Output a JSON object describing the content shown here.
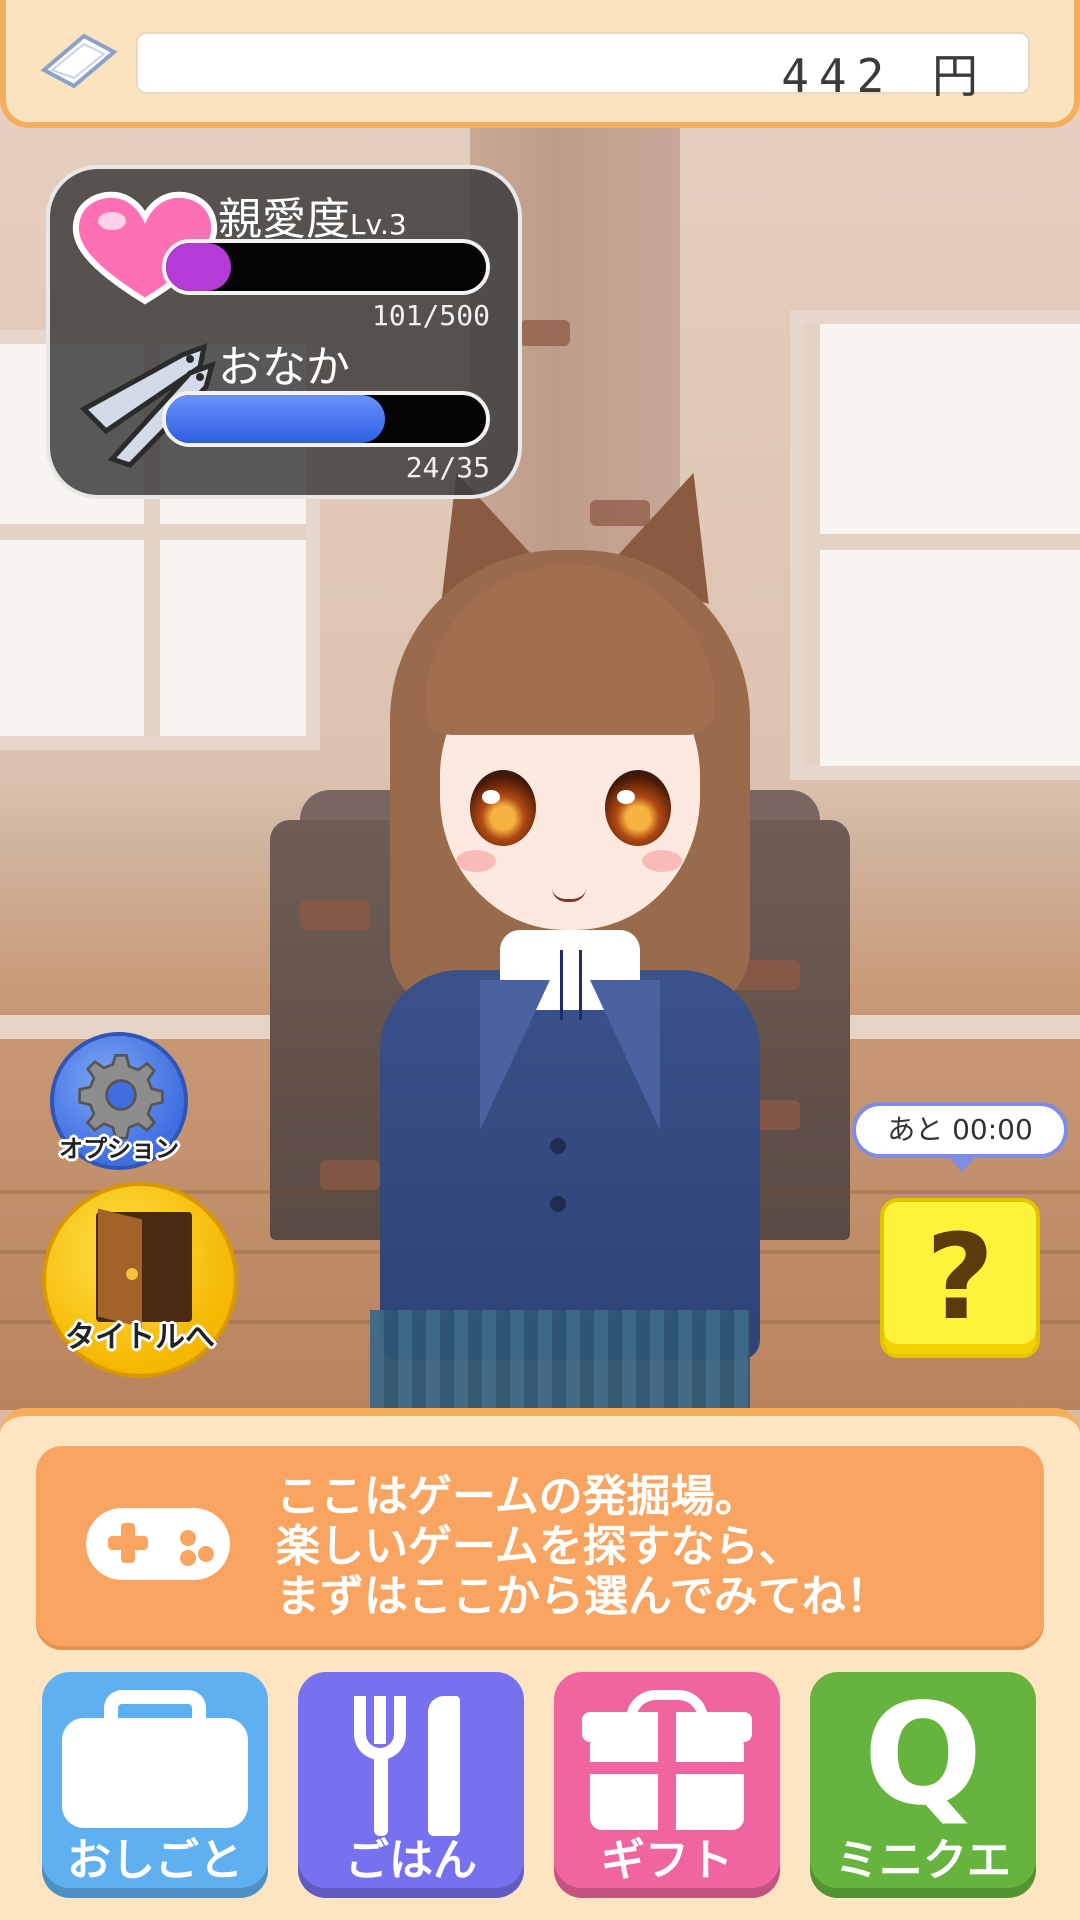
{
  "money": {
    "value": "442 円"
  },
  "status": {
    "affection": {
      "label": "親愛度",
      "level": "Lv.3",
      "count": "101/500",
      "current": 101,
      "max": 500,
      "color": "#b53bd6"
    },
    "hunger": {
      "label": "おなか",
      "count": "24/35",
      "current": 24,
      "max": 35,
      "color": "#2e5fe0"
    }
  },
  "side": {
    "option_label": "オプション",
    "title_label": "タイトルへ"
  },
  "miniquest": {
    "timer": "あと 00:00",
    "symbol": "?"
  },
  "message": {
    "line1": "ここはゲームの発掘場。",
    "line2": "楽しいゲームを探すなら、",
    "line3": "まずはここから選んでみてね！"
  },
  "menu": {
    "work": "おしごと",
    "food": "ごはん",
    "gift": "ギフト",
    "quest": "ミニクエ",
    "quest_letter": "Q"
  },
  "colors": {
    "accent_orange": "#f6ae5a",
    "work": "#5fb0f0",
    "food": "#7771ef",
    "gift": "#f065a0",
    "quest": "#66b43e"
  }
}
